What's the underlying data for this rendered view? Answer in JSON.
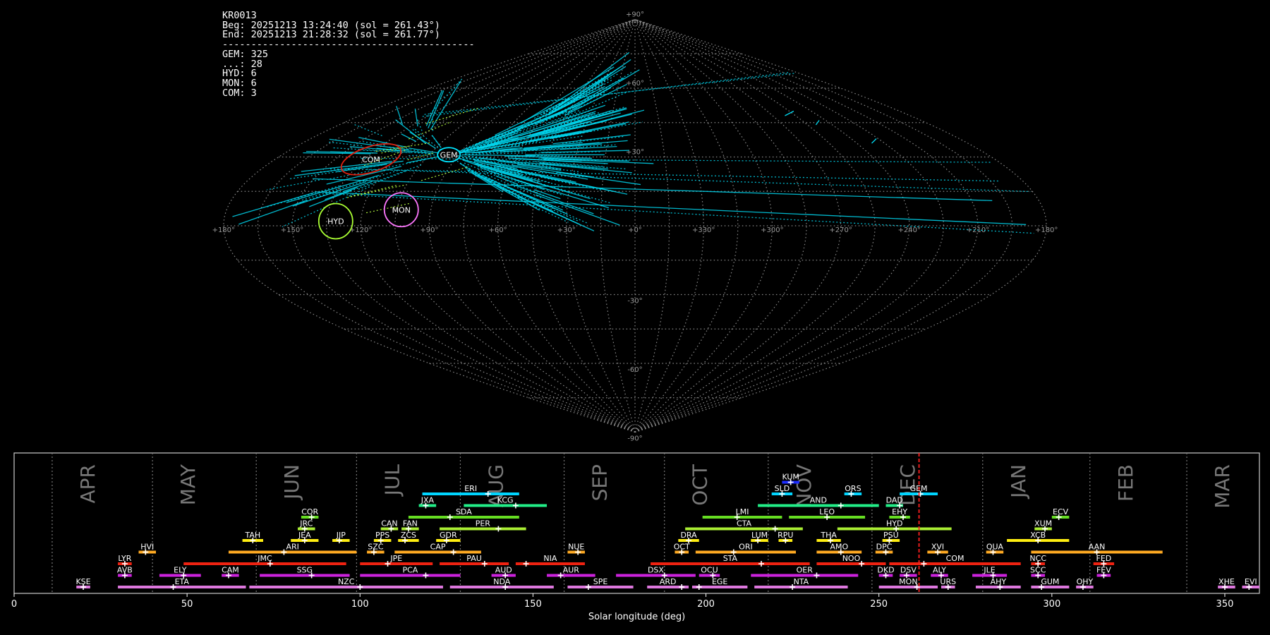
{
  "info": {
    "lines": [
      "KR0013",
      "Beg: 20251213 13:24:40 (sol = 261.43°)",
      "End: 20251213 21:28:32 (sol = 261.77°)",
      "--------------------------------------------",
      "GEM: 325",
      "...: 28",
      "HYD: 6",
      "MON: 6",
      "COM: 3"
    ]
  },
  "sky": {
    "projection": "sinusoidal",
    "longitude_labels": [
      "+180°",
      "+150°",
      "+120°",
      "+90°",
      "+60°",
      "+30°",
      "+0°",
      "+330°",
      "+300°",
      "+270°",
      "+240°",
      "+210°",
      "+180°"
    ],
    "latitude_labels": [
      "+90°",
      "+60°",
      "+30°",
      "-30°",
      "-60°",
      "-90°"
    ],
    "radiants": [
      {
        "code": "COM",
        "color": "#e02010",
        "ra": 132,
        "dec": 29
      },
      {
        "code": "GEM",
        "color": "#00e5ff",
        "ra": 95,
        "dec": 31
      },
      {
        "code": "HYD",
        "color": "#aaff33",
        "ra": 131,
        "dec": 2
      },
      {
        "code": "MON",
        "color": "#ff77ff",
        "ra": 103,
        "dec": 7
      }
    ]
  },
  "chart_data": {
    "type": "timeline",
    "xlabel": "Solar longitude (deg)",
    "xlim": [
      0,
      360
    ],
    "xticks": [
      0,
      50,
      100,
      150,
      200,
      250,
      300,
      350
    ],
    "current_sol": 261.6,
    "months": [
      {
        "label": "APR",
        "start": 11
      },
      {
        "label": "MAY",
        "start": 40
      },
      {
        "label": "JUN",
        "start": 70
      },
      {
        "label": "JUL",
        "start": 99
      },
      {
        "label": "AUG",
        "start": 129
      },
      {
        "label": "SEP",
        "start": 159
      },
      {
        "label": "OCT",
        "start": 188
      },
      {
        "label": "NOV",
        "start": 218
      },
      {
        "label": "DEC",
        "start": 248
      },
      {
        "label": "JAN",
        "start": 280
      },
      {
        "label": "FEB",
        "start": 311
      },
      {
        "label": "MAR",
        "start": 339
      }
    ],
    "showers": [
      {
        "code": "KUM",
        "row": 9,
        "start": 222,
        "end": 227,
        "peak": 224.5,
        "color": "#1a2aff"
      },
      {
        "code": "ERI",
        "row": 8,
        "start": 118,
        "end": 146,
        "peak": 137,
        "color": "#00d5ff"
      },
      {
        "code": "SLD",
        "row": 8,
        "start": 219,
        "end": 225,
        "peak": 222,
        "color": "#00d5ff"
      },
      {
        "code": "ORS",
        "row": 8,
        "start": 240,
        "end": 245,
        "peak": 242,
        "color": "#00d5ff"
      },
      {
        "code": "GEM",
        "row": 8,
        "start": 256,
        "end": 267,
        "peak": 262,
        "color": "#00d5ff"
      },
      {
        "code": "JXA",
        "row": 7,
        "start": 117,
        "end": 122,
        "peak": 119,
        "color": "#22ee88"
      },
      {
        "code": "KCG",
        "row": 7,
        "start": 130,
        "end": 154,
        "peak": 145,
        "color": "#22ee88"
      },
      {
        "code": "AND",
        "row": 7,
        "start": 215,
        "end": 250,
        "peak": 239,
        "color": "#22ee88"
      },
      {
        "code": "DAD",
        "row": 7,
        "start": 252,
        "end": 257,
        "peak": 256,
        "color": "#22ee88"
      },
      {
        "code": "COR",
        "row": 6,
        "start": 83,
        "end": 88,
        "peak": 86,
        "color": "#66dd22"
      },
      {
        "code": "SDA",
        "row": 6,
        "start": 114,
        "end": 146,
        "peak": 126,
        "color": "#66dd22"
      },
      {
        "code": "LMI",
        "row": 6,
        "start": 199,
        "end": 222,
        "peak": 209,
        "color": "#66dd22"
      },
      {
        "code": "LEO",
        "row": 6,
        "start": 224,
        "end": 246,
        "peak": 235,
        "color": "#66dd22"
      },
      {
        "code": "EHY",
        "row": 6,
        "start": 253,
        "end": 259,
        "peak": 257,
        "color": "#66dd22"
      },
      {
        "code": "ECV",
        "row": 6,
        "start": 300,
        "end": 305,
        "peak": 302,
        "color": "#66dd22"
      },
      {
        "code": "JRC",
        "row": 5,
        "start": 82,
        "end": 87,
        "peak": 84,
        "color": "#aaee33"
      },
      {
        "code": "CAN",
        "row": 5,
        "start": 106,
        "end": 111,
        "peak": 109,
        "color": "#aaee33"
      },
      {
        "code": "FAN",
        "row": 5,
        "start": 112,
        "end": 117,
        "peak": 114,
        "color": "#aaee33"
      },
      {
        "code": "PER",
        "row": 5,
        "start": 123,
        "end": 148,
        "peak": 140,
        "color": "#aaee33"
      },
      {
        "code": "CTA",
        "row": 5,
        "start": 194,
        "end": 228,
        "peak": 220,
        "color": "#aaee33"
      },
      {
        "code": "HYD",
        "row": 5,
        "start": 238,
        "end": 271,
        "peak": 255,
        "color": "#aaee33"
      },
      {
        "code": "XUM",
        "row": 5,
        "start": 295,
        "end": 300,
        "peak": 298,
        "color": "#aaee33"
      },
      {
        "code": "TAH",
        "row": 4,
        "start": 66,
        "end": 72,
        "peak": 69,
        "color": "#ffee11"
      },
      {
        "code": "JEA",
        "row": 4,
        "start": 80,
        "end": 88,
        "peak": 84,
        "color": "#ffee11"
      },
      {
        "code": "JIP",
        "row": 4,
        "start": 92,
        "end": 97,
        "peak": 94,
        "color": "#ffee11"
      },
      {
        "code": "PPS",
        "row": 4,
        "start": 104,
        "end": 109,
        "peak": 106,
        "color": "#ffee11"
      },
      {
        "code": "ZCS",
        "row": 4,
        "start": 111,
        "end": 117,
        "peak": 113,
        "color": "#ffee11"
      },
      {
        "code": "GDR",
        "row": 4,
        "start": 122,
        "end": 129,
        "peak": 125,
        "color": "#ffee11"
      },
      {
        "code": "DRA",
        "row": 4,
        "start": 192,
        "end": 198,
        "peak": 195,
        "color": "#ffee11"
      },
      {
        "code": "LUM",
        "row": 4,
        "start": 213,
        "end": 218,
        "peak": 215,
        "color": "#ffee11"
      },
      {
        "code": "RPU",
        "row": 4,
        "start": 221,
        "end": 225,
        "peak": 223,
        "color": "#ffee11"
      },
      {
        "code": "THA",
        "row": 4,
        "start": 232,
        "end": 239,
        "peak": 236,
        "color": "#ffee11"
      },
      {
        "code": "PSU",
        "row": 4,
        "start": 251,
        "end": 256,
        "peak": 253,
        "color": "#ffee11"
      },
      {
        "code": "XCB",
        "row": 4,
        "start": 287,
        "end": 305,
        "peak": 296,
        "color": "#ffee11"
      },
      {
        "code": "HVI",
        "row": 3,
        "start": 36,
        "end": 41,
        "peak": 38,
        "color": "#ffaa22"
      },
      {
        "code": "ARI",
        "row": 3,
        "start": 62,
        "end": 99,
        "peak": 78,
        "color": "#ffaa22"
      },
      {
        "code": "SZC",
        "row": 3,
        "start": 102,
        "end": 107,
        "peak": 104,
        "color": "#ffaa22"
      },
      {
        "code": "CAP",
        "row": 3,
        "start": 110,
        "end": 135,
        "peak": 127,
        "color": "#ffaa22"
      },
      {
        "code": "NUE",
        "row": 3,
        "start": 160,
        "end": 165,
        "peak": 163,
        "color": "#ffaa22"
      },
      {
        "code": "OCT",
        "row": 3,
        "start": 191,
        "end": 195,
        "peak": 193,
        "color": "#ffaa22"
      },
      {
        "code": "ORI",
        "row": 3,
        "start": 197,
        "end": 226,
        "peak": 208,
        "color": "#ffaa22"
      },
      {
        "code": "AMO",
        "row": 3,
        "start": 232,
        "end": 245,
        "peak": 239,
        "color": "#ffaa22"
      },
      {
        "code": "DPC",
        "row": 3,
        "start": 249,
        "end": 254,
        "peak": 252,
        "color": "#ffaa22"
      },
      {
        "code": "XVI",
        "row": 3,
        "start": 264,
        "end": 270,
        "peak": 267,
        "color": "#ffaa22"
      },
      {
        "code": "QUA",
        "row": 3,
        "start": 281,
        "end": 286,
        "peak": 283,
        "color": "#ffaa22"
      },
      {
        "code": "AAN",
        "row": 3,
        "start": 294,
        "end": 332,
        "peak": 313,
        "color": "#ffaa22"
      },
      {
        "code": "LYR",
        "row": 2,
        "start": 30,
        "end": 34,
        "peak": 32,
        "color": "#ee2211"
      },
      {
        "code": "JMC",
        "row": 2,
        "start": 49,
        "end": 96,
        "peak": 74,
        "color": "#ee2211"
      },
      {
        "code": "JPE",
        "row": 2,
        "start": 100,
        "end": 121,
        "peak": 108,
        "color": "#ee2211"
      },
      {
        "code": "PAU",
        "row": 2,
        "start": 123,
        "end": 143,
        "peak": 136,
        "color": "#ee2211"
      },
      {
        "code": "NIA",
        "row": 2,
        "start": 145,
        "end": 165,
        "peak": 148,
        "color": "#ee2211"
      },
      {
        "code": "STA",
        "row": 2,
        "start": 184,
        "end": 230,
        "peak": 216,
        "color": "#ee2211"
      },
      {
        "code": "NOO",
        "row": 2,
        "start": 232,
        "end": 252,
        "peak": 245,
        "color": "#ee2211"
      },
      {
        "code": "COM",
        "row": 2,
        "start": 253,
        "end": 291,
        "peak": 263,
        "color": "#ee2211"
      },
      {
        "code": "NCC",
        "row": 2,
        "start": 294,
        "end": 298,
        "peak": 296,
        "color": "#ee2211"
      },
      {
        "code": "FED",
        "row": 2,
        "start": 312,
        "end": 318,
        "peak": 315,
        "color": "#ee2211"
      },
      {
        "code": "AVB",
        "row": 1,
        "start": 30,
        "end": 34,
        "peak": 32,
        "color": "#cc22dd"
      },
      {
        "code": "ELY",
        "row": 1,
        "start": 42,
        "end": 54,
        "peak": 49,
        "color": "#cc22dd"
      },
      {
        "code": "CAM",
        "row": 1,
        "start": 60,
        "end": 65,
        "peak": 62,
        "color": "#cc22dd"
      },
      {
        "code": "SSG",
        "row": 1,
        "start": 71,
        "end": 97,
        "peak": 86,
        "color": "#cc22dd"
      },
      {
        "code": "PCA",
        "row": 1,
        "start": 100,
        "end": 129,
        "peak": 119,
        "color": "#cc22dd"
      },
      {
        "code": "AUD",
        "row": 1,
        "start": 138,
        "end": 145,
        "peak": 142,
        "color": "#cc22dd"
      },
      {
        "code": "AUR",
        "row": 1,
        "start": 154,
        "end": 168,
        "peak": 158,
        "color": "#cc22dd"
      },
      {
        "code": "DSX",
        "row": 1,
        "start": 174,
        "end": 197,
        "peak": 188,
        "color": "#cc22dd"
      },
      {
        "code": "OCU",
        "row": 1,
        "start": 198,
        "end": 204,
        "peak": 202,
        "color": "#cc22dd"
      },
      {
        "code": "OER",
        "row": 1,
        "start": 213,
        "end": 244,
        "peak": 232,
        "color": "#cc22dd"
      },
      {
        "code": "DKD",
        "row": 1,
        "start": 250,
        "end": 254,
        "peak": 252,
        "color": "#cc22dd"
      },
      {
        "code": "DSV",
        "row": 1,
        "start": 256,
        "end": 261,
        "peak": 258,
        "color": "#cc22dd"
      },
      {
        "code": "ALY",
        "row": 1,
        "start": 265,
        "end": 270,
        "peak": 268,
        "color": "#cc22dd"
      },
      {
        "code": "JLE",
        "row": 1,
        "start": 277,
        "end": 287,
        "peak": 283,
        "color": "#cc22dd"
      },
      {
        "code": "SCC",
        "row": 1,
        "start": 294,
        "end": 298,
        "peak": 296,
        "color": "#cc22dd"
      },
      {
        "code": "FEV",
        "row": 1,
        "start": 313,
        "end": 317,
        "peak": 315,
        "color": "#cc22dd"
      },
      {
        "code": "KSE",
        "row": 0,
        "start": 18,
        "end": 22,
        "peak": 20,
        "color": "#dd77dd"
      },
      {
        "code": "ETA",
        "row": 0,
        "start": 30,
        "end": 67,
        "peak": 46,
        "color": "#dd77dd"
      },
      {
        "code": "NZC",
        "row": 0,
        "start": 68,
        "end": 124,
        "peak": 100,
        "color": "#dd77dd"
      },
      {
        "code": "NDA",
        "row": 0,
        "start": 126,
        "end": 156,
        "peak": 142,
        "color": "#dd77dd"
      },
      {
        "code": "SPE",
        "row": 0,
        "start": 160,
        "end": 179,
        "peak": 166,
        "color": "#dd77dd"
      },
      {
        "code": "ARD",
        "row": 0,
        "start": 183,
        "end": 195,
        "peak": 193,
        "color": "#dd77dd"
      },
      {
        "code": "EGE",
        "row": 0,
        "start": 196,
        "end": 212,
        "peak": 198,
        "color": "#dd77dd"
      },
      {
        "code": "NTA",
        "row": 0,
        "start": 214,
        "end": 241,
        "peak": 225,
        "color": "#dd77dd"
      },
      {
        "code": "MON",
        "row": 0,
        "start": 250,
        "end": 267,
        "peak": 261,
        "color": "#dd77dd"
      },
      {
        "code": "URS",
        "row": 0,
        "start": 268,
        "end": 272,
        "peak": 270,
        "color": "#dd77dd"
      },
      {
        "code": "AHY",
        "row": 0,
        "start": 278,
        "end": 291,
        "peak": 285,
        "color": "#dd77dd"
      },
      {
        "code": "GUM",
        "row": 0,
        "start": 294,
        "end": 305,
        "peak": 297,
        "color": "#dd77dd"
      },
      {
        "code": "OHY",
        "row": 0,
        "start": 307,
        "end": 312,
        "peak": 309,
        "color": "#dd77dd"
      },
      {
        "code": "XHE",
        "row": 0,
        "start": 348,
        "end": 353,
        "peak": 350,
        "color": "#dd77dd"
      },
      {
        "code": "EVI",
        "row": 0,
        "start": 355,
        "end": 360,
        "peak": 357,
        "color": "#dd77dd"
      }
    ]
  }
}
